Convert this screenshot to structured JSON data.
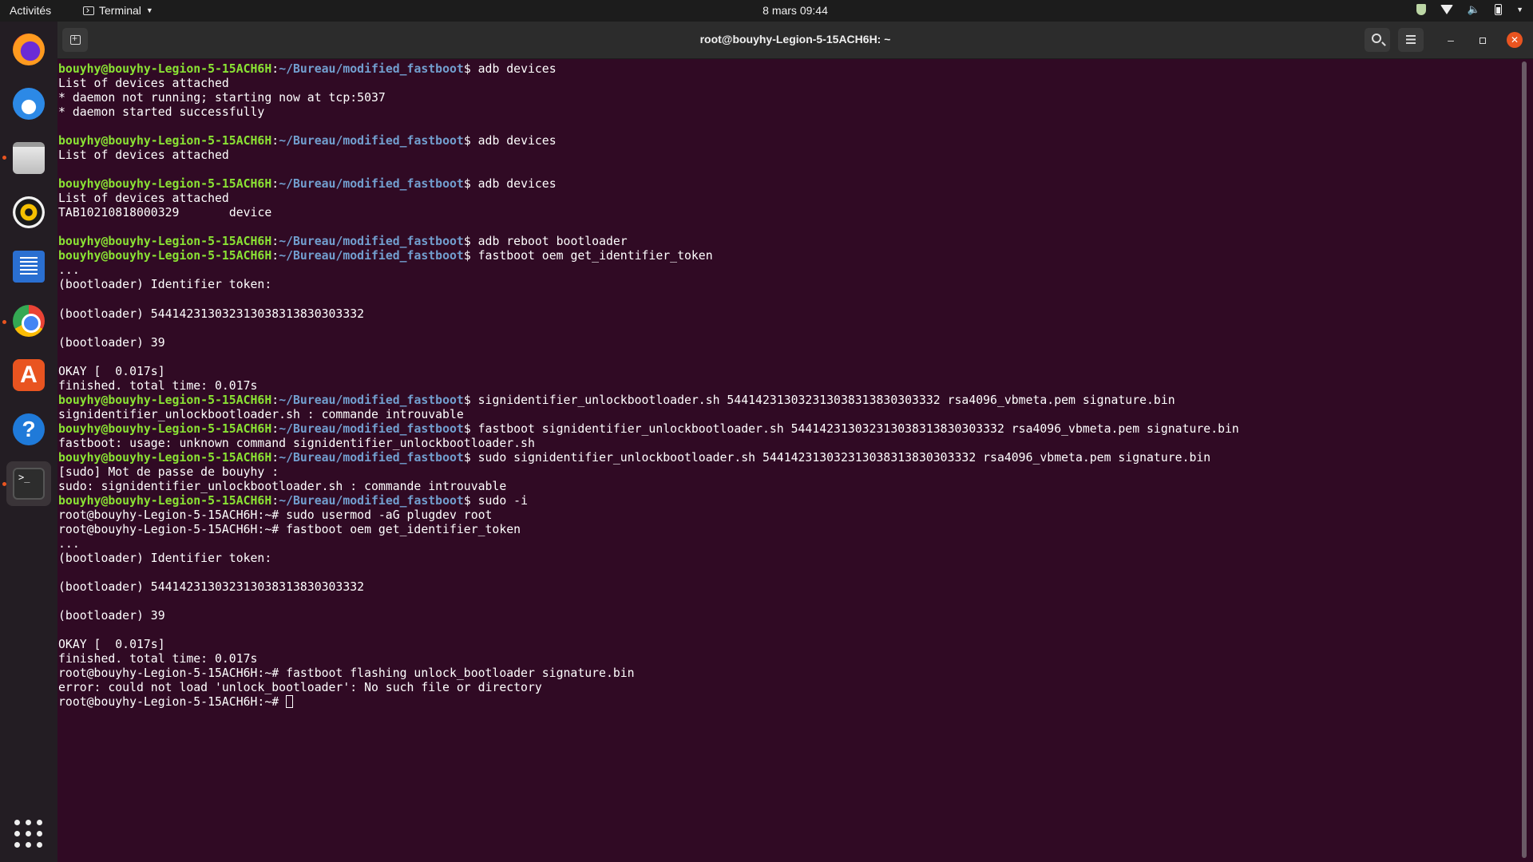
{
  "topbar": {
    "activities": "Activités",
    "app_name": "Terminal",
    "clock": "8 mars  09:44"
  },
  "window": {
    "title": "root@bouyhy-Legion-5-15ACH6H: ~"
  },
  "prompt": {
    "user": "bouyhy@bouyhy-Legion-5-15ACH6H",
    "path": "~/Bureau/modified_fastboot"
  },
  "terminal": [
    {
      "type": "prompt",
      "u": "bouyhy@bouyhy-Legion-5-15ACH6H",
      "sep": ":",
      "p": "~/Bureau/modified_fastboot",
      "rest": "$ adb devices"
    },
    {
      "type": "text",
      "text": "List of devices attached"
    },
    {
      "type": "text",
      "text": "* daemon not running; starting now at tcp:5037"
    },
    {
      "type": "text",
      "text": "* daemon started successfully"
    },
    {
      "type": "text",
      "text": ""
    },
    {
      "type": "prompt",
      "u": "bouyhy@bouyhy-Legion-5-15ACH6H",
      "sep": ":",
      "p": "~/Bureau/modified_fastboot",
      "rest": "$ adb devices"
    },
    {
      "type": "text",
      "text": "List of devices attached"
    },
    {
      "type": "text",
      "text": ""
    },
    {
      "type": "prompt",
      "u": "bouyhy@bouyhy-Legion-5-15ACH6H",
      "sep": ":",
      "p": "~/Bureau/modified_fastboot",
      "rest": "$ adb devices"
    },
    {
      "type": "text",
      "text": "List of devices attached"
    },
    {
      "type": "text",
      "text": "TAB10210818000329\tdevice"
    },
    {
      "type": "text",
      "text": ""
    },
    {
      "type": "prompt",
      "u": "bouyhy@bouyhy-Legion-5-15ACH6H",
      "sep": ":",
      "p": "~/Bureau/modified_fastboot",
      "rest": "$ adb reboot bootloader"
    },
    {
      "type": "prompt",
      "u": "bouyhy@bouyhy-Legion-5-15ACH6H",
      "sep": ":",
      "p": "~/Bureau/modified_fastboot",
      "rest": "$ fastboot oem get_identifier_token"
    },
    {
      "type": "text",
      "text": "..."
    },
    {
      "type": "text",
      "text": "(bootloader) Identifier token:"
    },
    {
      "type": "text",
      "text": ""
    },
    {
      "type": "text",
      "text": "(bootloader) 544142313032313038313830303332"
    },
    {
      "type": "text",
      "text": ""
    },
    {
      "type": "text",
      "text": "(bootloader) 39"
    },
    {
      "type": "text",
      "text": ""
    },
    {
      "type": "text",
      "text": "OKAY [  0.017s]"
    },
    {
      "type": "text",
      "text": "finished. total time: 0.017s"
    },
    {
      "type": "prompt",
      "u": "bouyhy@bouyhy-Legion-5-15ACH6H",
      "sep": ":",
      "p": "~/Bureau/modified_fastboot",
      "rest": "$ signidentifier_unlockbootloader.sh 544142313032313038313830303332 rsa4096_vbmeta.pem signature.bin"
    },
    {
      "type": "text",
      "text": "signidentifier_unlockbootloader.sh : commande introuvable"
    },
    {
      "type": "prompt",
      "u": "bouyhy@bouyhy-Legion-5-15ACH6H",
      "sep": ":",
      "p": "~/Bureau/modified_fastboot",
      "rest": "$ fastboot signidentifier_unlockbootloader.sh 544142313032313038313830303332 rsa4096_vbmeta.pem signature.bin"
    },
    {
      "type": "text",
      "text": "fastboot: usage: unknown command signidentifier_unlockbootloader.sh"
    },
    {
      "type": "prompt",
      "u": "bouyhy@bouyhy-Legion-5-15ACH6H",
      "sep": ":",
      "p": "~/Bureau/modified_fastboot",
      "rest": "$ sudo signidentifier_unlockbootloader.sh 544142313032313038313830303332 rsa4096_vbmeta.pem signature.bin"
    },
    {
      "type": "text",
      "text": "[sudo] Mot de passe de bouyhy :"
    },
    {
      "type": "text",
      "text": "sudo: signidentifier_unlockbootloader.sh : commande introuvable"
    },
    {
      "type": "prompt",
      "u": "bouyhy@bouyhy-Legion-5-15ACH6H",
      "sep": ":",
      "p": "~/Bureau/modified_fastboot",
      "rest": "$ sudo -i"
    },
    {
      "type": "text",
      "text": "root@bouyhy-Legion-5-15ACH6H:~# sudo usermod -aG plugdev root"
    },
    {
      "type": "text",
      "text": "root@bouyhy-Legion-5-15ACH6H:~# fastboot oem get_identifier_token"
    },
    {
      "type": "text",
      "text": "..."
    },
    {
      "type": "text",
      "text": "(bootloader) Identifier token:"
    },
    {
      "type": "text",
      "text": ""
    },
    {
      "type": "text",
      "text": "(bootloader) 544142313032313038313830303332"
    },
    {
      "type": "text",
      "text": ""
    },
    {
      "type": "text",
      "text": "(bootloader) 39"
    },
    {
      "type": "text",
      "text": ""
    },
    {
      "type": "text",
      "text": "OKAY [  0.017s]"
    },
    {
      "type": "text",
      "text": "finished. total time: 0.017s"
    },
    {
      "type": "text",
      "text": "root@bouyhy-Legion-5-15ACH6H:~# fastboot flashing unlock_bootloader signature.bin"
    },
    {
      "type": "text",
      "text": "error: could not load 'unlock_bootloader': No such file or directory"
    },
    {
      "type": "cursor",
      "text": "root@bouyhy-Legion-5-15ACH6H:~# "
    }
  ],
  "dock": [
    {
      "name": "firefox-icon",
      "active": false,
      "running": false
    },
    {
      "name": "thunderbird-icon",
      "active": false,
      "running": false
    },
    {
      "name": "files-icon",
      "active": false,
      "running": true
    },
    {
      "name": "rhythmbox-icon",
      "active": false,
      "running": false
    },
    {
      "name": "libreoffice-writer-icon",
      "active": false,
      "running": false
    },
    {
      "name": "chrome-icon",
      "active": false,
      "running": true
    },
    {
      "name": "app-store-icon",
      "active": false,
      "running": false
    },
    {
      "name": "help-icon",
      "active": false,
      "running": false
    },
    {
      "name": "terminal-icon",
      "active": true,
      "running": true
    }
  ],
  "colors": {
    "terminal_bg": "#300a24",
    "prompt_user": "#8ae234",
    "prompt_path": "#729fcf",
    "accent": "#e95420"
  }
}
